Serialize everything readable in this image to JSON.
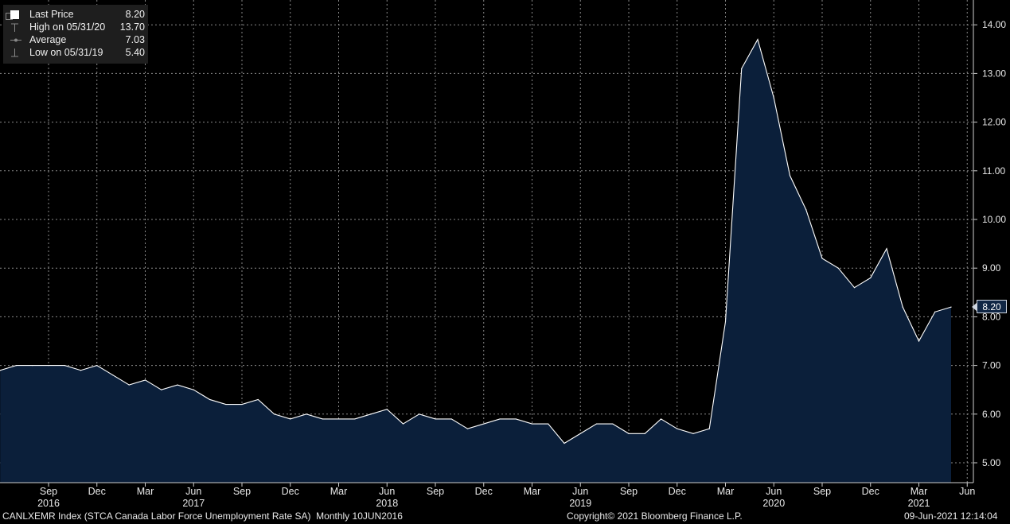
{
  "legend": {
    "last_price": {
      "label": "Last Price",
      "value": "8.20"
    },
    "high": {
      "label": "High on 05/31/20",
      "value": "13.70"
    },
    "average": {
      "label": "Average",
      "value": "7.03"
    },
    "low": {
      "label": "Low on 05/31/19",
      "value": "5.40"
    }
  },
  "last_value_box": "8.20",
  "footer": {
    "left": "CANLXEMR Index (STCA Canada Labor Force Unemployment Rate SA)  Monthly 10JUN2016",
    "center": "Copyright© 2021 Bloomberg Finance L.P.",
    "right": "09-Jun-2021 12:14:04"
  },
  "colors": {
    "area": "#0b1f3a",
    "line": "#ffffff",
    "grid": "#8a8a8a",
    "background": "#000000"
  },
  "chart_data": {
    "type": "area",
    "title": "",
    "xlabel": "",
    "ylabel": "",
    "ylim": [
      4.6,
      14.5
    ],
    "grid": true,
    "legend_position": "top-left",
    "y_ticks": [
      "5.00",
      "6.00",
      "7.00",
      "8.00",
      "9.00",
      "10.00",
      "11.00",
      "12.00",
      "13.00",
      "14.00"
    ],
    "x_month_ticks": [
      {
        "label": "Sep",
        "date": "2016-09"
      },
      {
        "label": "Dec",
        "date": "2016-12"
      },
      {
        "label": "Mar",
        "date": "2017-03"
      },
      {
        "label": "Jun",
        "date": "2017-06"
      },
      {
        "label": "Sep",
        "date": "2017-09"
      },
      {
        "label": "Dec",
        "date": "2017-12"
      },
      {
        "label": "Mar",
        "date": "2018-03"
      },
      {
        "label": "Jun",
        "date": "2018-06"
      },
      {
        "label": "Sep",
        "date": "2018-09"
      },
      {
        "label": "Dec",
        "date": "2018-12"
      },
      {
        "label": "Mar",
        "date": "2019-03"
      },
      {
        "label": "Jun",
        "date": "2019-06"
      },
      {
        "label": "Sep",
        "date": "2019-09"
      },
      {
        "label": "Dec",
        "date": "2019-12"
      },
      {
        "label": "Mar",
        "date": "2020-03"
      },
      {
        "label": "Jun",
        "date": "2020-06"
      },
      {
        "label": "Sep",
        "date": "2020-09"
      },
      {
        "label": "Dec",
        "date": "2020-12"
      },
      {
        "label": "Mar",
        "date": "2021-03"
      },
      {
        "label": "Jun",
        "date": "2021-06"
      }
    ],
    "x_year_labels": [
      {
        "label": "2016",
        "date": "2016-09"
      },
      {
        "label": "2017",
        "date": "2017-06"
      },
      {
        "label": "2018",
        "date": "2018-06"
      },
      {
        "label": "2019",
        "date": "2019-06"
      },
      {
        "label": "2020",
        "date": "2020-06"
      },
      {
        "label": "2021",
        "date": "2021-03"
      }
    ],
    "series": [
      {
        "x": [
          "2016-06",
          "2016-07",
          "2016-08",
          "2016-09",
          "2016-10",
          "2016-11",
          "2016-12",
          "2017-01",
          "2017-02",
          "2017-03",
          "2017-04",
          "2017-05",
          "2017-06",
          "2017-07",
          "2017-08",
          "2017-09",
          "2017-10",
          "2017-11",
          "2017-12",
          "2018-01",
          "2018-02",
          "2018-03",
          "2018-04",
          "2018-05",
          "2018-06",
          "2018-07",
          "2018-08",
          "2018-09",
          "2018-10",
          "2018-11",
          "2018-12",
          "2019-01",
          "2019-02",
          "2019-03",
          "2019-04",
          "2019-05",
          "2019-06",
          "2019-07",
          "2019-08",
          "2019-09",
          "2019-10",
          "2019-11",
          "2019-12",
          "2020-01",
          "2020-02",
          "2020-03",
          "2020-04",
          "2020-05",
          "2020-06",
          "2020-07",
          "2020-08",
          "2020-09",
          "2020-10",
          "2020-11",
          "2020-12",
          "2021-01",
          "2021-02",
          "2021-03",
          "2021-04",
          "2021-05"
        ],
        "values": [
          6.9,
          7.0,
          7.0,
          7.0,
          7.0,
          6.9,
          7.0,
          6.8,
          6.6,
          6.7,
          6.5,
          6.6,
          6.5,
          6.3,
          6.2,
          6.2,
          6.3,
          6.0,
          5.9,
          6.0,
          5.9,
          5.9,
          5.9,
          6.0,
          6.1,
          5.8,
          6.0,
          5.9,
          5.9,
          5.7,
          5.8,
          5.9,
          5.9,
          5.8,
          5.8,
          5.4,
          5.6,
          5.8,
          5.8,
          5.6,
          5.6,
          5.9,
          5.7,
          5.6,
          5.7,
          7.9,
          13.1,
          13.7,
          12.5,
          10.9,
          10.2,
          9.2,
          9.0,
          8.6,
          8.8,
          9.4,
          8.2,
          7.5,
          8.1,
          8.2
        ]
      }
    ]
  }
}
